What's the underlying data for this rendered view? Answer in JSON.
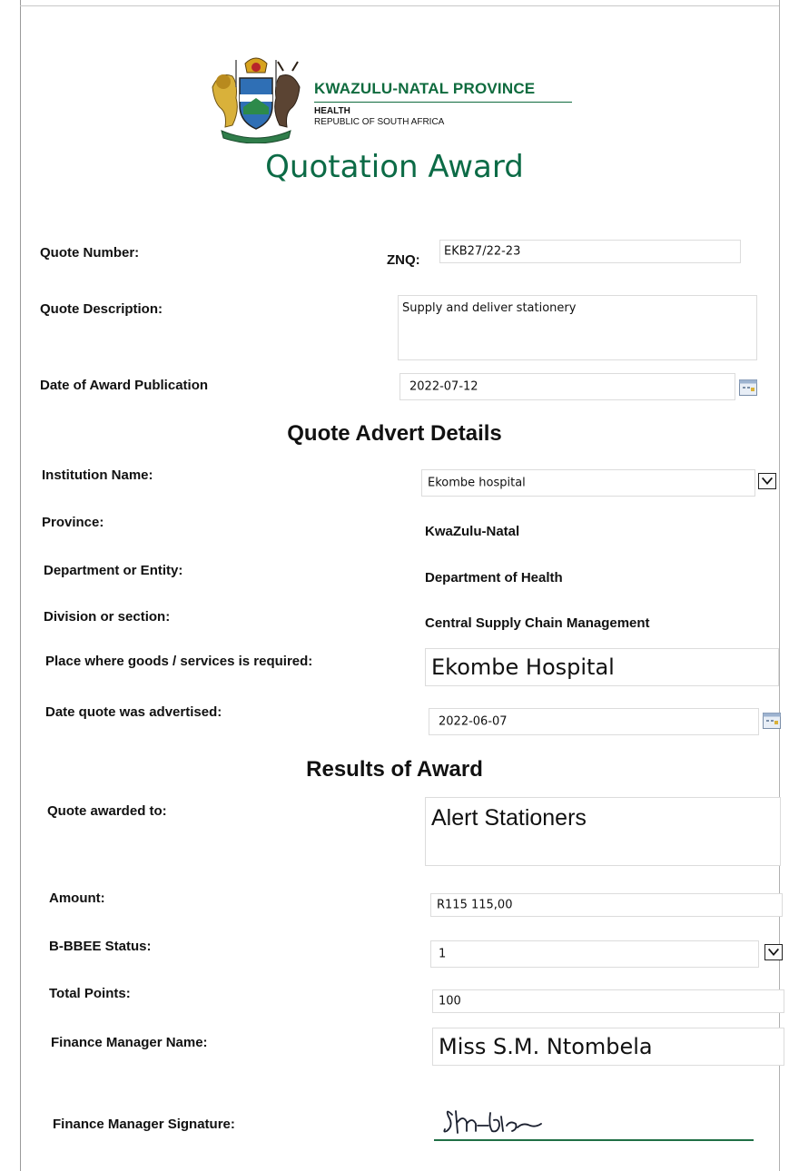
{
  "header": {
    "org_name": "KWAZULU-NATAL PROVINCE",
    "department": "HEALTH",
    "country": "REPUBLIC OF SOUTH AFRICA",
    "logo_icon": "coat-of-arms-icon"
  },
  "title": "Quotation Award",
  "quote": {
    "number_label": "Quote Number:",
    "number_prefix": "ZNQ:",
    "number_value": "EKB27/22-23",
    "description_label": "Quote Description:",
    "description_value": "Supply and deliver stationery",
    "publication_label": "Date of Award Publication",
    "publication_value": "2022-07-12"
  },
  "advert": {
    "heading": "Quote Advert Details",
    "institution_label": "Institution Name:",
    "institution_value": "Ekombe hospital",
    "province_label": "Province:",
    "province_value": "KwaZulu-Natal",
    "department_label": "Department or Entity:",
    "department_value": "Department of Health",
    "division_label": "Division or section:",
    "division_value": "Central Supply Chain Management",
    "place_label": "Place where goods /  services is required:",
    "place_value": "Ekombe Hospital",
    "advertised_label": "Date quote was advertised:",
    "advertised_value": "2022-06-07"
  },
  "results": {
    "heading": "Results of Award",
    "awarded_label": "Quote awarded to:",
    "awarded_value": "Alert Stationers",
    "amount_label": "Amount:",
    "amount_value": "R115 115,00",
    "bbbee_label": "B-BBEE Status:",
    "bbbee_value": "1",
    "points_label": "Total Points:",
    "points_value": "100",
    "manager_label": "Finance Manager Name:",
    "manager_value": "Miss S.M. Ntombela",
    "signature_label": "Finance Manager Signature:",
    "signature_text": "SMNtombela"
  },
  "colors": {
    "brand_green": "#0c6b46",
    "line_green": "#1f6f45",
    "text": "#111111"
  }
}
